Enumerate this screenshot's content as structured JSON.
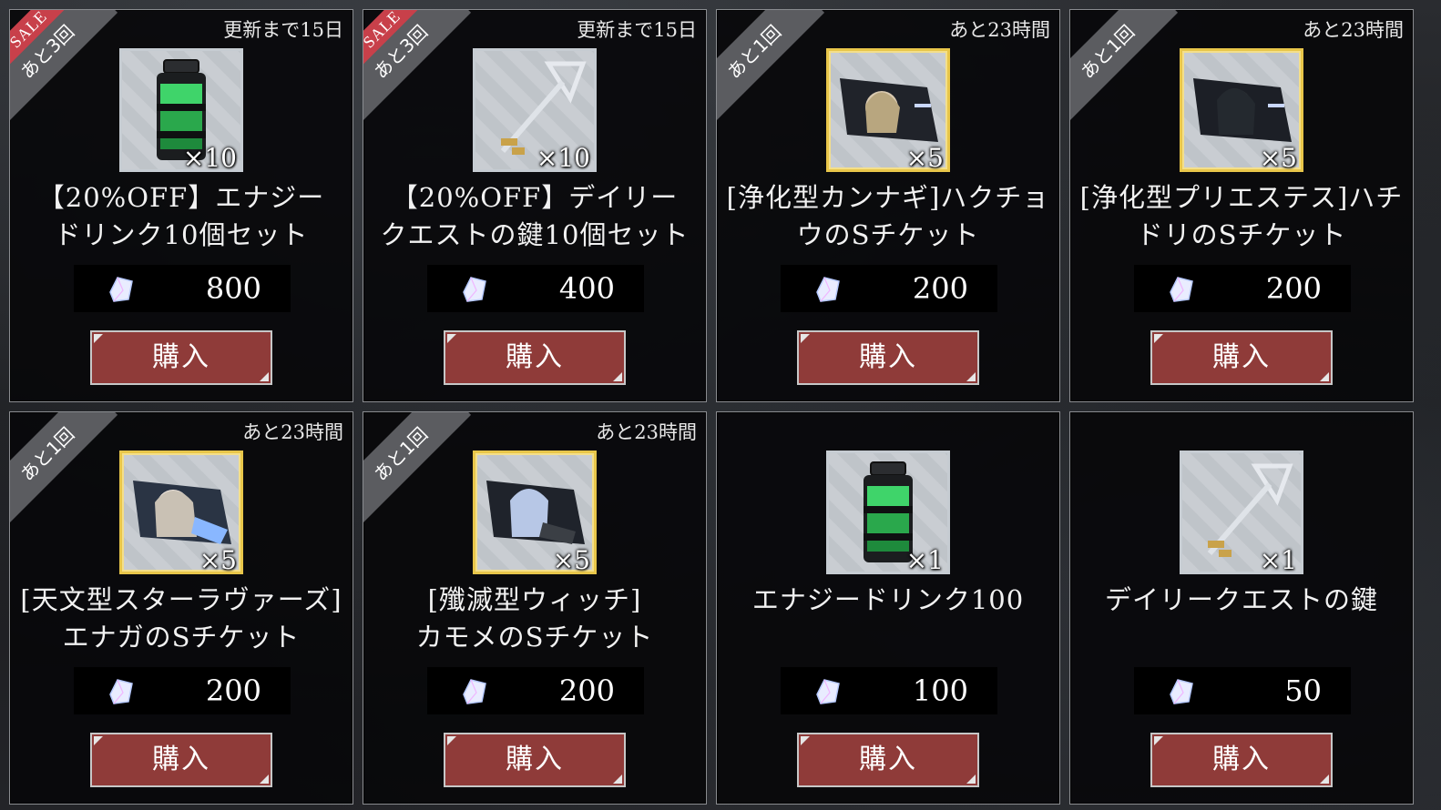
{
  "items": [
    {
      "sale": "SALE",
      "limit": "あと3回",
      "timer": "更新まで15日",
      "icon": "energy-drink-icon",
      "frame": "silver",
      "qty": "×10",
      "name": "【20%OFF】エナジー\nドリンク10個セット",
      "price": "800",
      "buy": "購入"
    },
    {
      "sale": "SALE",
      "limit": "あと3回",
      "timer": "更新まで15日",
      "icon": "key-icon",
      "frame": "silver",
      "qty": "×10",
      "name": "【20%OFF】デイリー\nクエストの鍵10個セット",
      "price": "400",
      "buy": "購入"
    },
    {
      "sale": "",
      "limit": "あと1回",
      "timer": "あと23時間",
      "icon": "ticket-icon",
      "frame": "gold",
      "qty": "×5",
      "name": "[浄化型カンナギ]ハクチョ\nウのSチケット",
      "price": "200",
      "buy": "購入"
    },
    {
      "sale": "",
      "limit": "あと1回",
      "timer": "あと23時間",
      "icon": "ticket-icon",
      "frame": "gold",
      "qty": "×5",
      "name": "[浄化型プリエステス]ハチ\nドリのSチケット",
      "price": "200",
      "buy": "購入"
    },
    {
      "sale": "",
      "limit": "あと1回",
      "timer": "あと23時間",
      "icon": "ticket-icon",
      "frame": "gold",
      "qty": "×5",
      "name": "[天文型スターラヴァーズ]\nエナガのSチケット",
      "price": "200",
      "buy": "購入"
    },
    {
      "sale": "",
      "limit": "あと1回",
      "timer": "あと23時間",
      "icon": "ticket-icon",
      "frame": "gold",
      "qty": "×5",
      "name": "[殲滅型ウィッチ]\nカモメのSチケット",
      "price": "200",
      "buy": "購入"
    },
    {
      "sale": "",
      "limit": "",
      "timer": "",
      "icon": "energy-drink-icon",
      "frame": "silver",
      "qty": "×1",
      "name": "エナジードリンク100",
      "price": "100",
      "buy": "購入"
    },
    {
      "sale": "",
      "limit": "",
      "timer": "",
      "icon": "key-icon",
      "frame": "silver",
      "qty": "×1",
      "name": "デイリークエストの鍵",
      "price": "50",
      "buy": "購入"
    }
  ],
  "colors": {
    "buy_button": "#8f3b39",
    "sale_tag": "#c8404a",
    "gold_frame": "#e8c64a",
    "card_bg": "#08080a"
  }
}
